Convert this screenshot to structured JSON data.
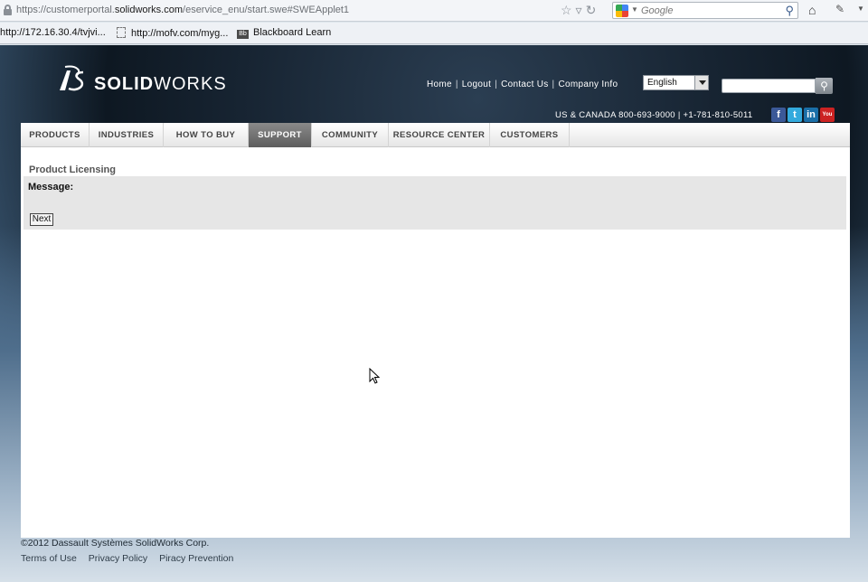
{
  "browser": {
    "url_prefix": "https://customerportal.",
    "url_domain": "solidworks.com",
    "url_path": "/eservice_enu/start.swe#SWEApplet1",
    "search_placeholder": "Google",
    "bookmarks": [
      {
        "label": "http://172.16.30.4/tvjvi..."
      },
      {
        "label": "http://mofv.com/myg..."
      },
      {
        "label": "Blackboard Learn",
        "icon_text": "Bb"
      }
    ]
  },
  "header": {
    "logo_prefix": "SOLID",
    "logo_suffix": "WORKS",
    "links": [
      "Home",
      "Logout",
      "Contact Us",
      "Company Info"
    ],
    "link_separator": "|",
    "language": "English",
    "phone": "US & CANADA 800-693-9000 | +1-781-810-5011",
    "social": [
      {
        "name": "facebook-icon",
        "glyph": "f",
        "color": "#3b5998"
      },
      {
        "name": "twitter-icon",
        "glyph": "t",
        "color": "#33aadd"
      },
      {
        "name": "linkedin-icon",
        "glyph": "in",
        "color": "#1a6fa8"
      },
      {
        "name": "youtube-icon",
        "glyph": "You",
        "color": "#cc2222"
      }
    ]
  },
  "nav": {
    "items": [
      "PRODUCTS",
      "INDUSTRIES",
      "HOW TO BUY",
      "SUPPORT",
      "COMMUNITY",
      "RESOURCE CENTER",
      "CUSTOMERS"
    ],
    "active": "SUPPORT"
  },
  "main": {
    "title": "Product Licensing",
    "message_label": "Message:",
    "next_label": "Next"
  },
  "footer": {
    "copyright": "©2012 Dassault Systèmes SolidWorks Corp.",
    "links": [
      "Terms of Use",
      "Privacy Policy",
      "Piracy Prevention"
    ]
  }
}
